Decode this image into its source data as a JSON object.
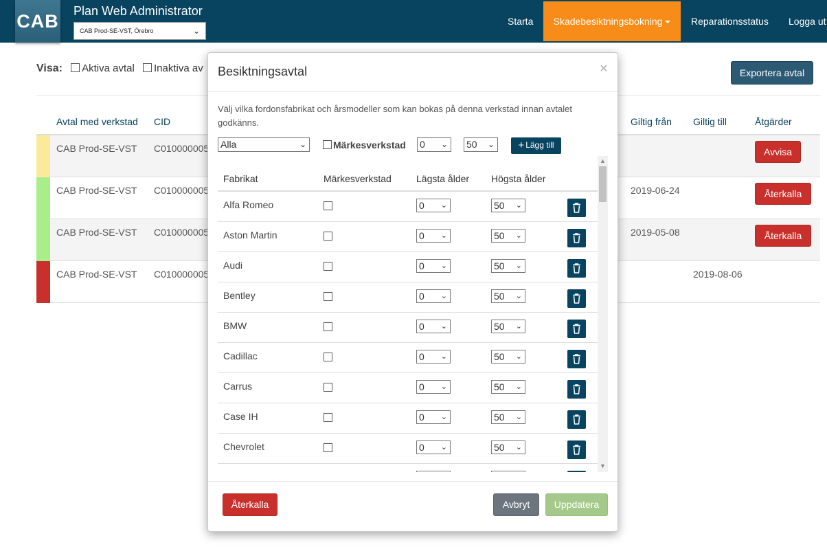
{
  "app": {
    "logo": "CAB",
    "title": "Plan Web Administrator",
    "site": "CAB Prod-SE-VST, Örebro"
  },
  "nav": {
    "start": "Starta",
    "booking": "Skadebesiktningsbokning",
    "repair": "Reparationsstatus",
    "logout": "Logga ut"
  },
  "page": {
    "visa_label": "Visa:",
    "active": "Aktiva avtal",
    "inactive": "Inaktiva av",
    "export": "Exportera avtal",
    "headers": {
      "workshop": "Avtal med verkstad",
      "cid": "CID",
      "from": "Giltig från",
      "to": "Giltig till",
      "actions": "Åtgärder"
    },
    "rows": [
      {
        "color": "#fcea9c",
        "workshop": "CAB Prod-SE-VST",
        "cid": "C010000005",
        "from": "",
        "to": "",
        "action": "Avvisa"
      },
      {
        "color": "#a8ee8b",
        "workshop": "CAB Prod-SE-VST",
        "cid": "C010000005",
        "from": "2019-06-24",
        "to": "",
        "action": "Återkalla"
      },
      {
        "color": "#a8ee8b",
        "workshop": "CAB Prod-SE-VST",
        "cid": "C010000005",
        "from": "2019-05-08",
        "to": "",
        "action": "Återkalla"
      },
      {
        "color": "#c9302c",
        "workshop": "CAB Prod-SE-VST",
        "cid": "C010000005",
        "from": "",
        "to": "2019-08-06",
        "action": ""
      }
    ]
  },
  "modal": {
    "title": "Besiktningsavtal",
    "close": "×",
    "description": "Välj vilka fordonsfabrikat och årsmodeller som kan bokas på denna verkstad innan avtalet godkänns.",
    "filter_make": "Alla",
    "brand_label": "Märkesverkstad",
    "filter_min": "0",
    "filter_max": "50",
    "add_plus": "+",
    "add": "Lägg till",
    "headers": {
      "make": "Fabrikat",
      "brand": "Märkesverkstad",
      "min": "Lägsta ålder",
      "max": "Högsta ålder"
    },
    "rows": [
      {
        "make": "Alfa Romeo",
        "min": "0",
        "max": "50"
      },
      {
        "make": "Aston Martin",
        "min": "0",
        "max": "50"
      },
      {
        "make": "Audi",
        "min": "0",
        "max": "50"
      },
      {
        "make": "Bentley",
        "min": "0",
        "max": "50"
      },
      {
        "make": "BMW",
        "min": "0",
        "max": "50"
      },
      {
        "make": "Cadillac",
        "min": "0",
        "max": "50"
      },
      {
        "make": "Carrus",
        "min": "0",
        "max": "50"
      },
      {
        "make": "Case IH",
        "min": "0",
        "max": "50"
      },
      {
        "make": "Chevrolet",
        "min": "0",
        "max": "50"
      },
      {
        "make": "",
        "min": "",
        "max": ""
      }
    ],
    "revoke": "Återkalla",
    "cancel": "Avbryt",
    "update": "Uppdatera"
  }
}
